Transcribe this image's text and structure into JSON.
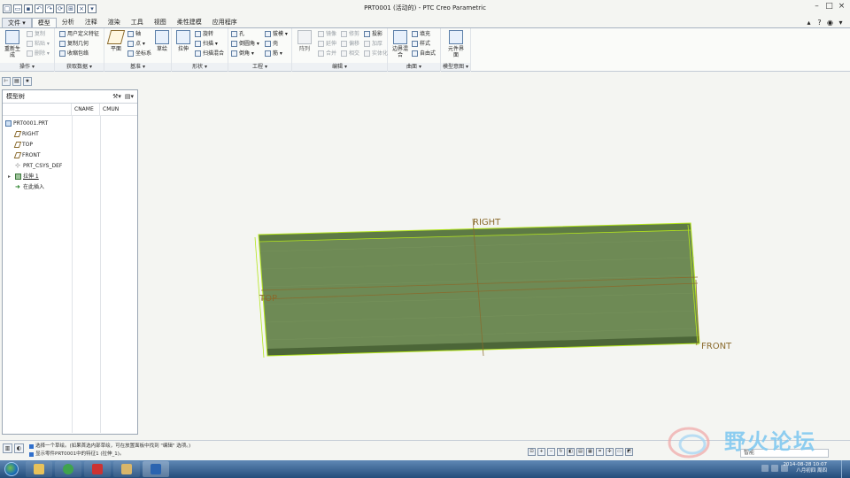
{
  "window": {
    "title": "PRT0001 (活动的) - PTC Creo Parametric"
  },
  "ribbon_tabs": [
    "文件 ▾",
    "模型",
    "分析",
    "注释",
    "渲染",
    "工具",
    "视图",
    "柔性建模",
    "应用程序"
  ],
  "ribbon": {
    "operations": {
      "label": "操作 ▾",
      "regenerate": "重新生成",
      "copy": "复制",
      "paste": "粘贴 ▾",
      "delete": "删除 ▾"
    },
    "get_data": {
      "label": "获取数据 ▾",
      "udf": "用户定义特征",
      "copy_geom": "复制几何",
      "shrinkwrap": "收缩包络"
    },
    "datum": {
      "label": "基准 ▾",
      "plane": "平面",
      "axis": "轴",
      "point": "点 ▾",
      "csys": "坐标系",
      "sketch": "草绘"
    },
    "shapes": {
      "label": "形状 ▾",
      "extrude": "拉伸",
      "revolve": "旋转",
      "sweep": "扫描 ▾",
      "swept_blend": "扫描混合"
    },
    "engineering": {
      "label": "工程 ▾",
      "hole": "孔",
      "round": "倒圆角 ▾",
      "chamfer": "倒角 ▾",
      "draft": "拔模 ▾",
      "shell": "壳",
      "rib": "筋 ▾"
    },
    "editing": {
      "label": "编辑 ▾",
      "pattern": "阵列",
      "mirror": "镜像",
      "extend": "延伸",
      "project": "投影",
      "trim": "修剪",
      "offset": "偏移",
      "thicken": "加厚",
      "merge": "合并",
      "intersect": "相交",
      "solidify": "实体化"
    },
    "surfaces": {
      "label": "曲面 ▾",
      "boundary_blend": "边界混合",
      "fill": "填充",
      "style": "样式",
      "freestyle": "自由式"
    },
    "model_intent": {
      "label": "模型意图 ▾",
      "component_interface": "元件界面"
    }
  },
  "model_tree": {
    "header": "模型树",
    "columns": [
      "",
      "CNAME",
      "CMUN"
    ],
    "nodes": [
      {
        "label": "PRT0001.PRT",
        "icon": "part-icon"
      },
      {
        "label": "RIGHT",
        "icon": "datum-plane-icon"
      },
      {
        "label": "TOP",
        "icon": "datum-plane-icon"
      },
      {
        "label": "FRONT",
        "icon": "datum-plane-icon"
      },
      {
        "label": "PRT_CSYS_DEF",
        "icon": "csys-icon"
      },
      {
        "label": "拉伸 1",
        "icon": "extrude-icon"
      },
      {
        "label": "在此插入",
        "icon": "insert-here-icon"
      }
    ]
  },
  "viewport": {
    "datum_labels": {
      "right": "RIGHT",
      "top": "TOP",
      "front": "FRONT"
    },
    "colors": {
      "solid": "#6e8a55",
      "edge_highlight": "#b5e61d",
      "datum": "#8a6a2c"
    }
  },
  "status": {
    "messages": [
      "选择一个草绘。(如果首选内部草绘，可在放置面板中找到 \"编辑\" 选项。)",
      "显示零件PRT0001中的特征1 (拉伸_1)。"
    ],
    "filter": "智能"
  },
  "watermark": "野火论坛",
  "taskbar": {
    "time": "2014-08-28  10:07",
    "date": "八月初四 周四"
  }
}
